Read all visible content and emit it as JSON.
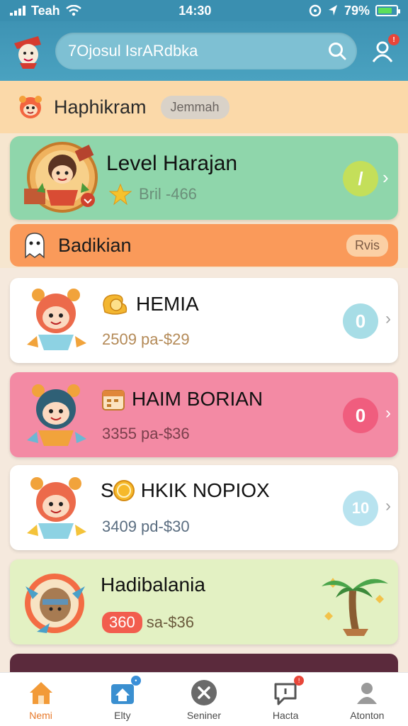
{
  "status_bar": {
    "carrier": "Teah",
    "time": "14:30",
    "battery": "79%"
  },
  "header": {
    "search_text": "7Ojosul IsrARdbka",
    "profile_badge": "!"
  },
  "section": {
    "title": "Haphikram",
    "chip": "Jemmah"
  },
  "level_card": {
    "title": "Level Harajan",
    "sub": "Bril -466",
    "pill": "/"
  },
  "banner": {
    "title": "Badikian",
    "chip": "Rvis"
  },
  "cards": [
    {
      "name": "HEMIA",
      "price": "2509 pa-$29",
      "pill": "0"
    },
    {
      "name": "HAIM BORIAN",
      "price": "3355 pa-$36",
      "pill": "0"
    },
    {
      "name": "HKIK NOPIOX",
      "price": "3409 pd-$30",
      "pill": "10",
      "lead": "S"
    },
    {
      "name": "Hadibalania",
      "price_highlight": "360",
      "price": "sa-$36"
    }
  ],
  "nav": {
    "items": [
      {
        "label": "Nemi"
      },
      {
        "label": "Elty"
      },
      {
        "label": "Seniner"
      },
      {
        "label": "Hacta"
      },
      {
        "label": "Atonton"
      }
    ]
  },
  "colors": {
    "accent_blue": "#3e93b4",
    "level_green": "#8fd6ab",
    "banner_orange": "#fa9a5a",
    "pink_card": "#f38aa4",
    "lime_card": "#e3f1c3"
  }
}
